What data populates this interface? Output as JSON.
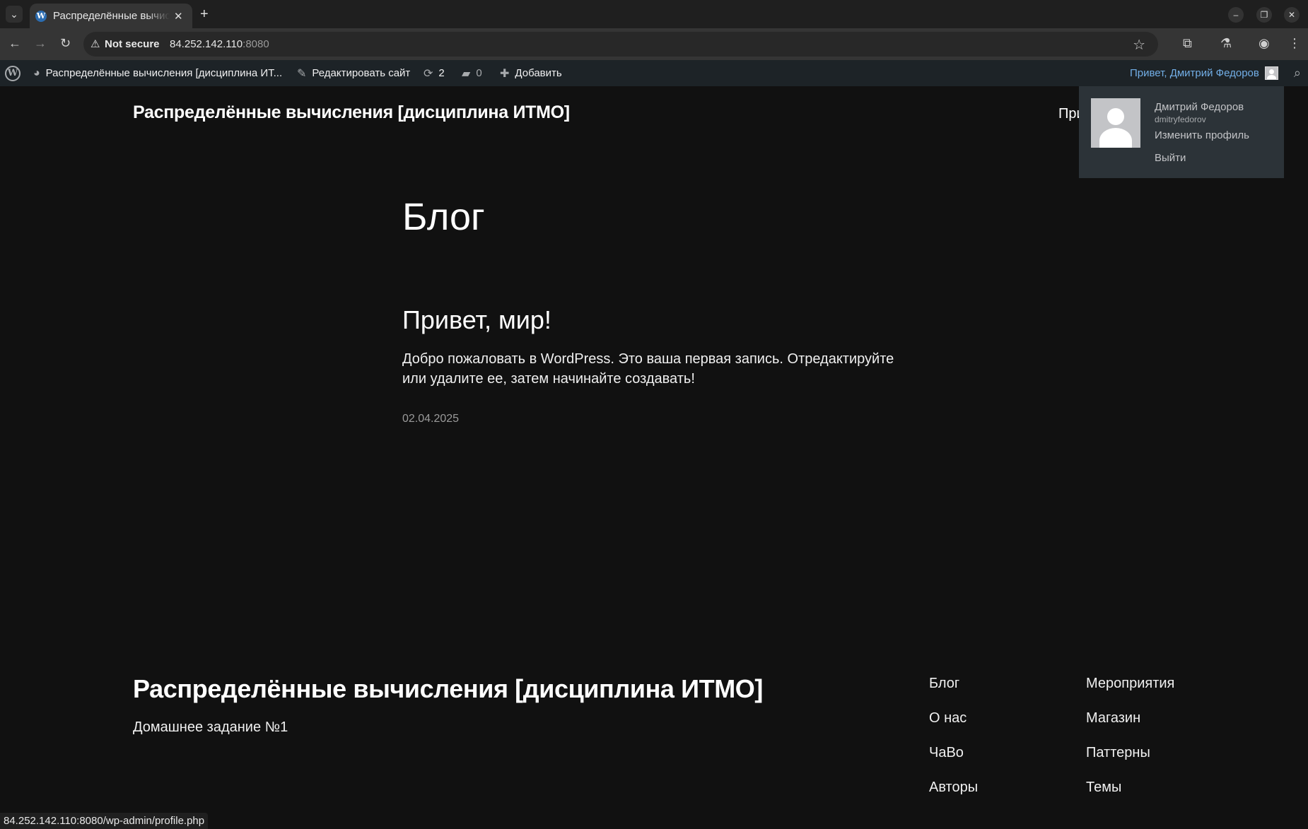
{
  "browser": {
    "tab_title": "Распределённые вычисления [дисциплина ИТМО]",
    "not_secure_label": "Not secure",
    "url_host": "84.252.142.110",
    "url_port": ":8080",
    "status_url": "84.252.142.110:8080/wp-admin/profile.php"
  },
  "adminbar": {
    "site_name": "Распределённые вычисления [дисциплина ИТ...",
    "edit_site": "Редактировать сайт",
    "updates_count": "2",
    "comments_count": "0",
    "add_new": "Добавить",
    "greeting": "Привет, Дмитрий Федоров"
  },
  "user_menu": {
    "display_name": "Дмитрий Федоров",
    "username": "dmitryfedorov",
    "edit_profile": "Изменить профиль",
    "logout": "Выйти"
  },
  "site": {
    "title": "Распределённые вычисления [дисциплина ИТМО]",
    "nav_partial": "При"
  },
  "main": {
    "page_title": "Блог",
    "post_title": "Привет, мир!",
    "post_excerpt": "Добро пожаловать в WordPress. Это ваша первая запись. Отредактируйте или удалите ее, затем начинайте создавать!",
    "post_date": "02.04.2025"
  },
  "footer": {
    "title": "Распределённые вычисления [дисциплина ИТМО]",
    "tagline": "Домашнее задание №1",
    "col1": [
      "Блог",
      "О нас",
      "ЧаВо",
      "Авторы"
    ],
    "col2": [
      "Мероприятия",
      "Магазин",
      "Паттерны",
      "Темы"
    ]
  },
  "icons": {
    "wp": "W",
    "dashboard": "◕",
    "brush": "✎",
    "updates": "⟳",
    "comments": "▰",
    "plus": "✚",
    "search": "⌕",
    "back": "←",
    "forward": "→",
    "reload": "↻",
    "warning": "⚠",
    "star": "☆",
    "extensions": "⧉",
    "labs": "⚗",
    "profile": "◉",
    "menu": "⋮",
    "tab_list": "⌄",
    "new_tab": "+",
    "minimize": "–",
    "restore": "❐",
    "close": "✕"
  }
}
